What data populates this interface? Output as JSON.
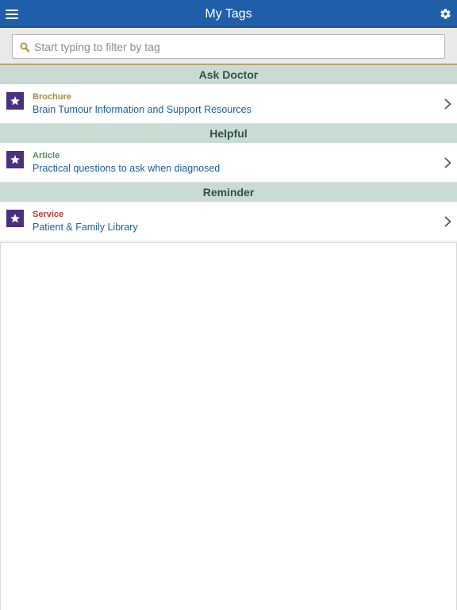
{
  "header": {
    "title": "My Tags",
    "menu_icon": "hamburger-menu-icon",
    "settings_icon": "gear-icon",
    "background_color": "#1f5ea8"
  },
  "search": {
    "placeholder": "Start typing to filter by tag",
    "value": "",
    "icon": "search-icon"
  },
  "sections": [
    {
      "title": "Ask Doctor",
      "items": [
        {
          "type": "Brochure",
          "type_color": "#a88b3e",
          "title": "Brain Tumour Information and Support Resources",
          "icon": "star-icon"
        }
      ]
    },
    {
      "title": "Helpful",
      "items": [
        {
          "type": "Article",
          "type_color": "#4f9060",
          "title": "Practical questions to ask when diagnosed",
          "icon": "star-icon"
        }
      ]
    },
    {
      "title": "Reminder",
      "items": [
        {
          "type": "Service",
          "type_color": "#b2402e",
          "title": "Patient & Family Library",
          "icon": "star-icon"
        }
      ]
    }
  ],
  "colors": {
    "section_header_bg": "#c9dbd2",
    "section_header_text": "#2f5148",
    "item_title": "#1a5e98",
    "star_badge": "#4b2f80"
  }
}
